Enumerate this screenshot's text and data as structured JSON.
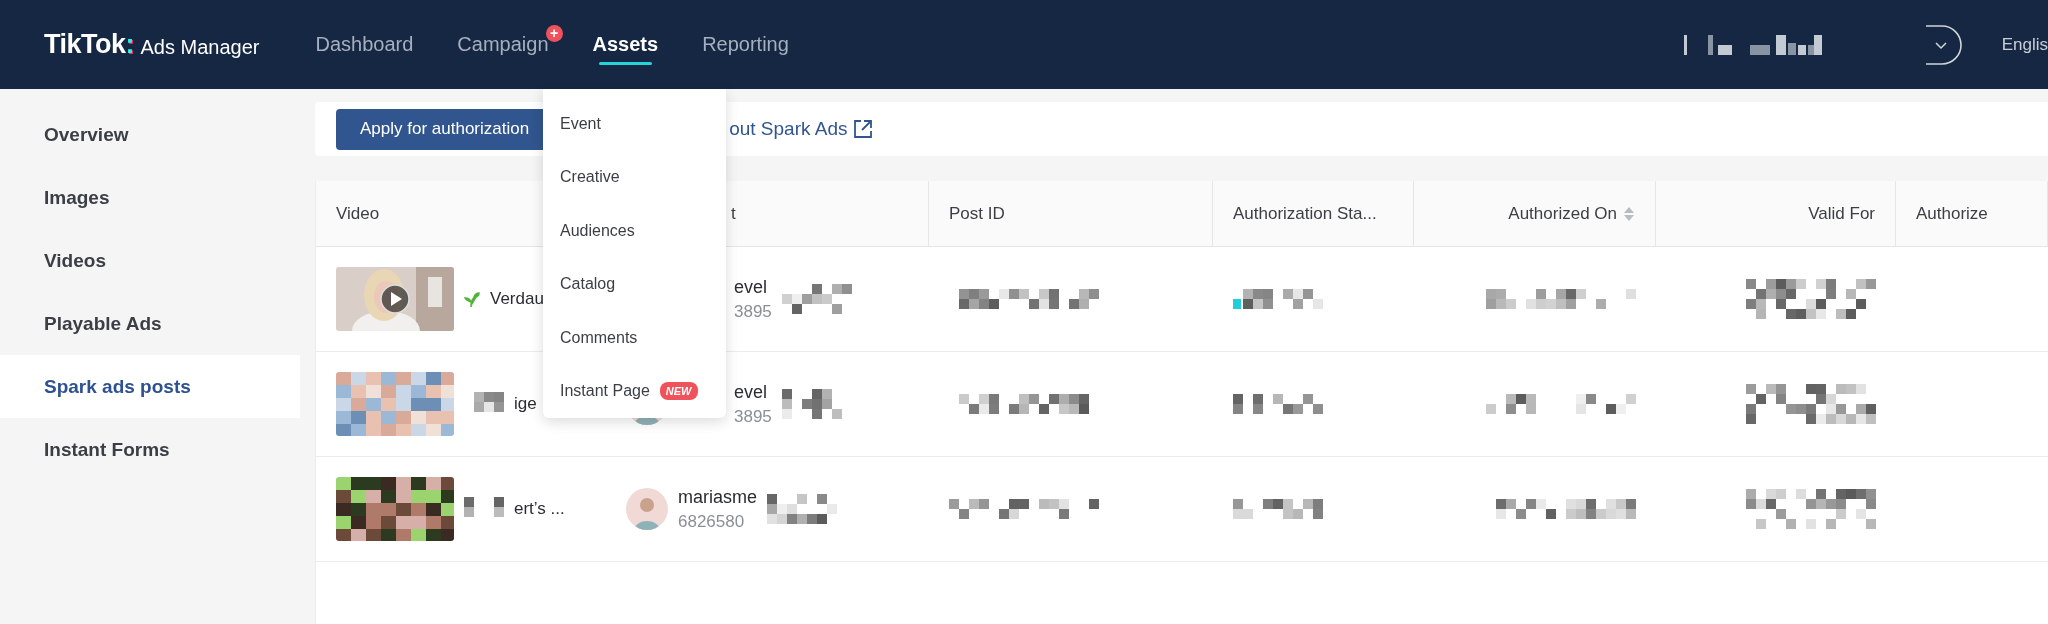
{
  "header": {
    "logo": "TikTok",
    "logo_separator": ":",
    "product": "Ads Manager",
    "language": "Englis"
  },
  "nav": [
    {
      "label": "Dashboard",
      "selected": false
    },
    {
      "label": "Campaign",
      "selected": false,
      "badge": "+"
    },
    {
      "label": "Assets",
      "selected": true
    },
    {
      "label": "Reporting",
      "selected": false
    }
  ],
  "sidebar": {
    "items": [
      {
        "label": "Overview",
        "selected": false
      },
      {
        "label": "Images",
        "selected": false
      },
      {
        "label": "Videos",
        "selected": false
      },
      {
        "label": "Playable Ads",
        "selected": false
      },
      {
        "label": "Spark ads posts",
        "selected": true
      },
      {
        "label": "Instant Forms",
        "selected": false
      }
    ]
  },
  "toolbar": {
    "button": "Apply for authorization",
    "link": "out Spark Ads"
  },
  "table": {
    "columns": [
      {
        "label": "Video",
        "sortable": false
      },
      {
        "label": "t",
        "sortable": false
      },
      {
        "label": "Post ID",
        "sortable": false
      },
      {
        "label": "Authorization Sta...",
        "sortable": false
      },
      {
        "label": "Authorized On",
        "sortable": true
      },
      {
        "label": "Valid For",
        "sortable": false
      },
      {
        "label": "Authorize",
        "sortable": false
      }
    ],
    "rows": [
      {
        "video_title": "Verdau",
        "sprout": true,
        "play_overlay": true,
        "account_name": "evel",
        "account_id": "3895",
        "avatar": false,
        "covered": true
      },
      {
        "video_title": "ige",
        "sprout": false,
        "play_overlay": false,
        "account_name": "evel",
        "account_id": "3895",
        "avatar": true,
        "covered": true
      },
      {
        "video_title": "ert’s ...",
        "sprout": false,
        "play_overlay": false,
        "account_name": "mariasme",
        "account_id": "6826580",
        "avatar": true,
        "covered": false
      }
    ]
  },
  "dropdown_menu": {
    "items": [
      {
        "label": "Event"
      },
      {
        "label": "Creative"
      },
      {
        "label": "Audiences"
      },
      {
        "label": "Catalog"
      },
      {
        "label": "Comments"
      },
      {
        "label": "Instant Page",
        "badge": "NEW"
      }
    ]
  }
}
